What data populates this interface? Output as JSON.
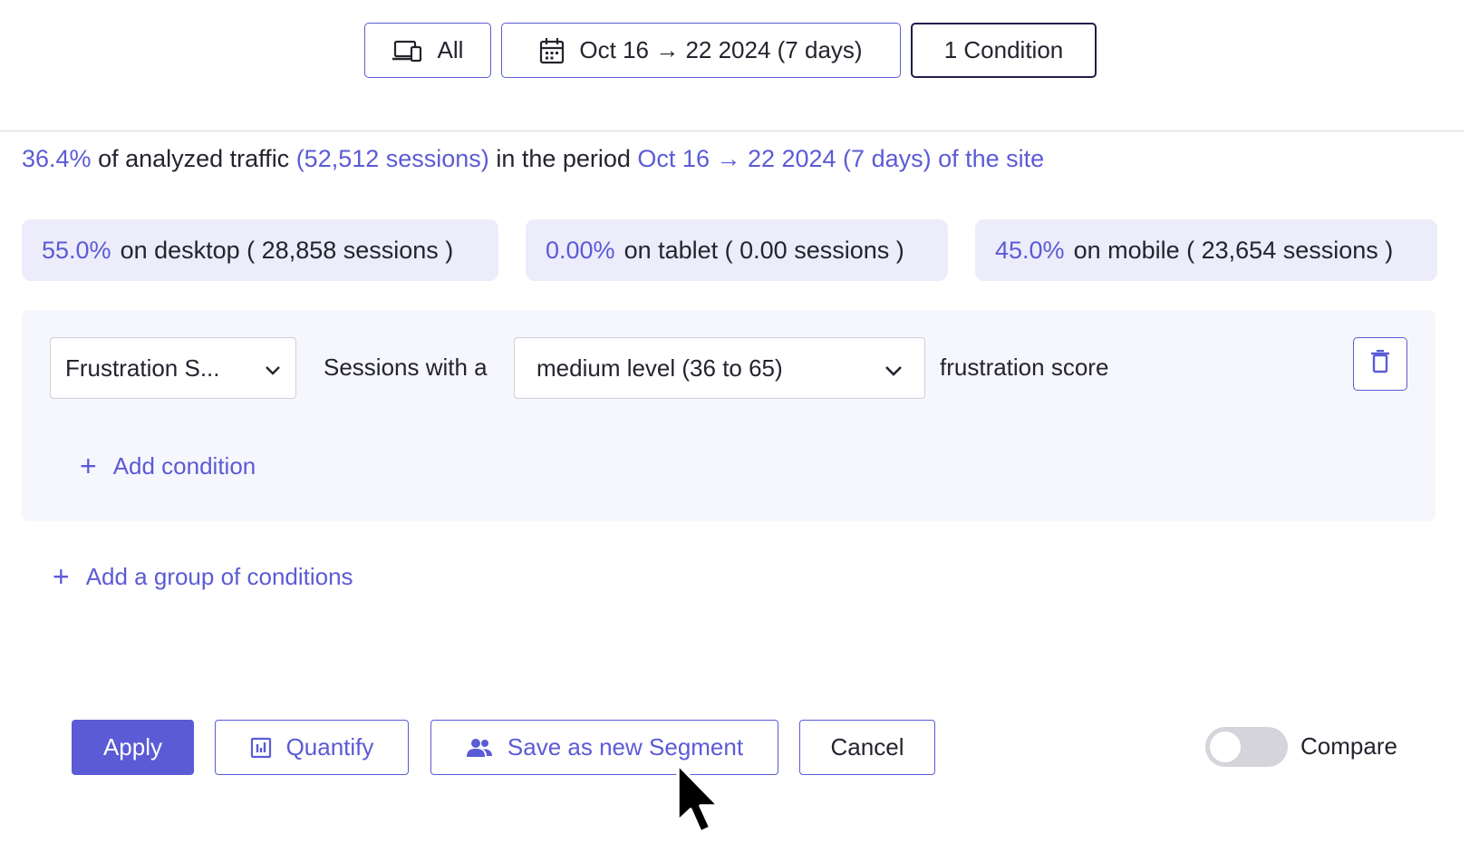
{
  "toolbar": {
    "device_label": "All",
    "date_label": "Oct 16 → 22 2024 (7 days)",
    "condition_label": "1 Condition"
  },
  "summary": {
    "percent": "36.4%",
    "text1": " of analyzed traffic ",
    "sessions": "(52,512 sessions)",
    "text2": " in the period ",
    "period": "Oct 16 → 22 2024 (7 days) of the site"
  },
  "devices": [
    {
      "pct": "55.0%",
      "label": "on desktop ( 28,858 sessions )"
    },
    {
      "pct": "0.00%",
      "label": "on tablet ( 0.00 sessions )"
    },
    {
      "pct": "45.0%",
      "label": "on mobile ( 23,654 sessions )"
    }
  ],
  "condition": {
    "field_value": "Frustration S...",
    "prefix_text": "Sessions with a",
    "level_value": "medium level (36 to 65)",
    "suffix_text": "frustration score",
    "add_condition_label": "Add condition"
  },
  "add_group_label": "Add a group of conditions",
  "actions": {
    "apply_label": "Apply",
    "quantify_label": "Quantify",
    "save_segment_label": "Save as new Segment",
    "cancel_label": "Cancel",
    "compare_label": "Compare",
    "compare_enabled": false
  },
  "colors": {
    "accent": "#5b5bd6",
    "pill_bg": "#ececfb",
    "panel_bg": "#f6f6fd",
    "text": "#24242f"
  },
  "icons": {
    "device": "devices-icon",
    "date": "calendar-icon",
    "chevron": "chevron-down-icon",
    "trash": "trash-icon",
    "plus": "plus-icon",
    "quantify": "bar-chart-icon",
    "segment": "users-icon",
    "cursor": "mouse-pointer-icon"
  }
}
